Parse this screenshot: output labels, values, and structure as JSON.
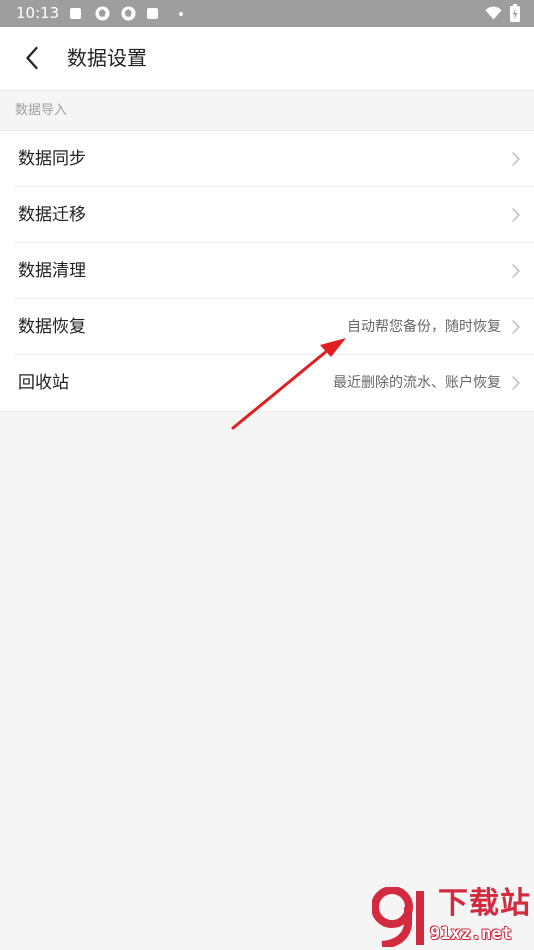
{
  "status_bar": {
    "time": "10:13",
    "icons": [
      "square-notification-icon",
      "aperture-icon",
      "aperture-icon",
      "square-notification-icon",
      "dot-icon",
      "wifi-icon",
      "battery-charging-icon"
    ]
  },
  "header": {
    "back_icon": "chevron-left-icon",
    "title": "数据设置"
  },
  "section": {
    "title": "数据导入"
  },
  "items": [
    {
      "label": "数据同步",
      "subtitle": ""
    },
    {
      "label": "数据迁移",
      "subtitle": ""
    },
    {
      "label": "数据清理",
      "subtitle": ""
    },
    {
      "label": "数据恢复",
      "subtitle": "自动帮您备份，随时恢复"
    },
    {
      "label": "回收站",
      "subtitle": "最近删除的流水、账户恢复"
    }
  ],
  "annotation": {
    "color": "#e02020"
  },
  "watermark": {
    "title": "下载站",
    "url": "91xz.net",
    "color": "#d22a3f"
  },
  "colors": {
    "status_bar": "#9e9e9e",
    "background": "#f5f5f5",
    "surface": "#ffffff",
    "primary_text": "#222222",
    "secondary_text": "#666666",
    "section_text": "#a0a0a0"
  }
}
